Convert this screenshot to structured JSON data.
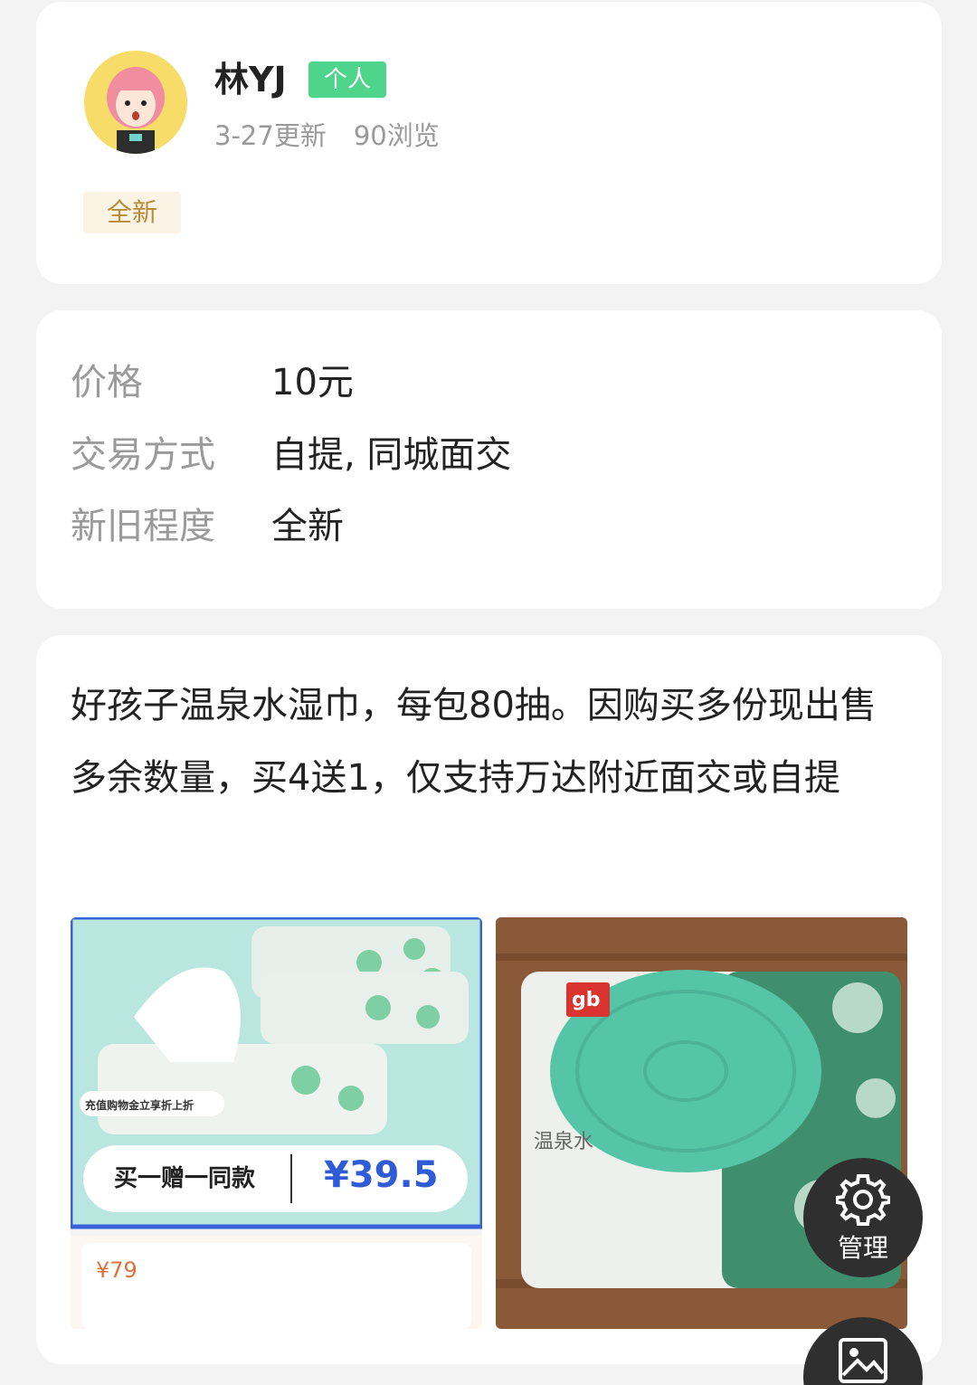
{
  "user": {
    "name": "林YJ",
    "badge": "个人",
    "updated": "3-27更新",
    "views": "90浏览",
    "condition_tag": "全新"
  },
  "info": {
    "price_label": "价格",
    "price_value": "10元",
    "trade_label": "交易方式",
    "trade_value": "自提, 同城面交",
    "condition_label": "新旧程度",
    "condition_value": "全新"
  },
  "description": "好孩子温泉水湿巾，每包80抽。因购买多份现出售多余数量，买4送1，仅支持万达附近面交或自提",
  "photos": {
    "photo1": {
      "banner_text": "充值购物金立享折上折",
      "promo_text": "买一赠一同款",
      "price": "¥39.5",
      "orig_price": "¥79"
    },
    "photo2": {
      "brand": "gb",
      "product_text": "温泉水"
    }
  },
  "fab": {
    "manage_label": "管理"
  },
  "colors": {
    "accent_green": "#4fd48c",
    "tag_gold": "#b88a3a",
    "fab_bg": "#2f2f2f"
  }
}
